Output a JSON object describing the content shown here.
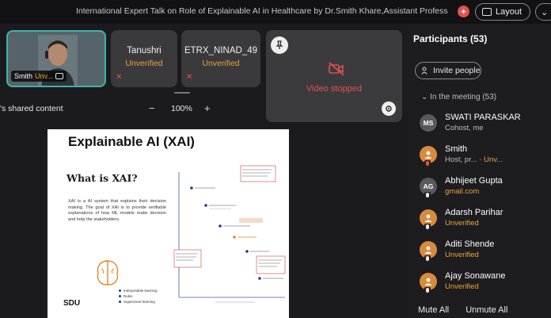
{
  "title_bar": {
    "title": "International Expert Talk on Role of Explainable AI in Healthcare by Dr.Smith Khare,Assistant Professor,Denmark",
    "layout_label": "Layout",
    "more_label": "⌄"
  },
  "tiles": {
    "self": {
      "name": "Smith",
      "status": "Unv...",
      "ring_color": "#3fb2b0"
    },
    "others": [
      {
        "name": "Tanushri",
        "status": "Unverified"
      },
      {
        "name": "ETRX_NINAD_49",
        "status": "Unverified"
      }
    ],
    "stopped": {
      "label": "Video stopped"
    }
  },
  "share": {
    "label": "'s shared content",
    "zoom_minus": "−",
    "zoom_value": "100%",
    "zoom_plus": "+"
  },
  "slide": {
    "title": "Explainable AI (XAI)",
    "subtitle": "What is XAI?",
    "body": "XAI is a AI system that explains their decision making. The goal of XAI is to provide verifiable explanations of how ML models make decision and help the stakeholders.",
    "logo_text": "SDU",
    "legend": [
      "Interpretable learning",
      "Rules",
      "Supervised learning"
    ]
  },
  "participants": {
    "title": "Participants (53)",
    "invite_label": "Invite people",
    "section_label": "In the meeting (53)",
    "people": [
      {
        "initials": "MS",
        "name": "SWATI PARASKAR",
        "sub": "Cohost, me",
        "sub2": "",
        "color": "gray",
        "mic": "none",
        "unverified": false
      },
      {
        "initials": "",
        "name": "Smith",
        "sub": "Host, pr...",
        "sub2": "Unv...",
        "color": "orange",
        "mic": "red",
        "unverified": false
      },
      {
        "initials": "AG",
        "name": "Abhijeet Gupta",
        "sub": "gmail.com",
        "sub2": "",
        "color": "gray",
        "mic": "white",
        "unverified": false
      },
      {
        "initials": "",
        "name": "Adarsh Parihar",
        "sub": "Unverified",
        "sub2": "",
        "color": "orange",
        "mic": "white",
        "unverified": true
      },
      {
        "initials": "",
        "name": "Aditi Shende",
        "sub": "Unverified",
        "sub2": "",
        "color": "orange",
        "mic": "white",
        "unverified": true
      },
      {
        "initials": "",
        "name": "Ajay Sonawane",
        "sub": "Unverified",
        "sub2": "",
        "color": "orange",
        "mic": "white",
        "unverified": true
      }
    ],
    "mute_all": "Mute All",
    "unmute_all": "Unmute All"
  },
  "colors": {
    "accent_unverified": "#e8a33c",
    "alert_red": "#e2504f",
    "self_ring": "#3fb2b0"
  }
}
